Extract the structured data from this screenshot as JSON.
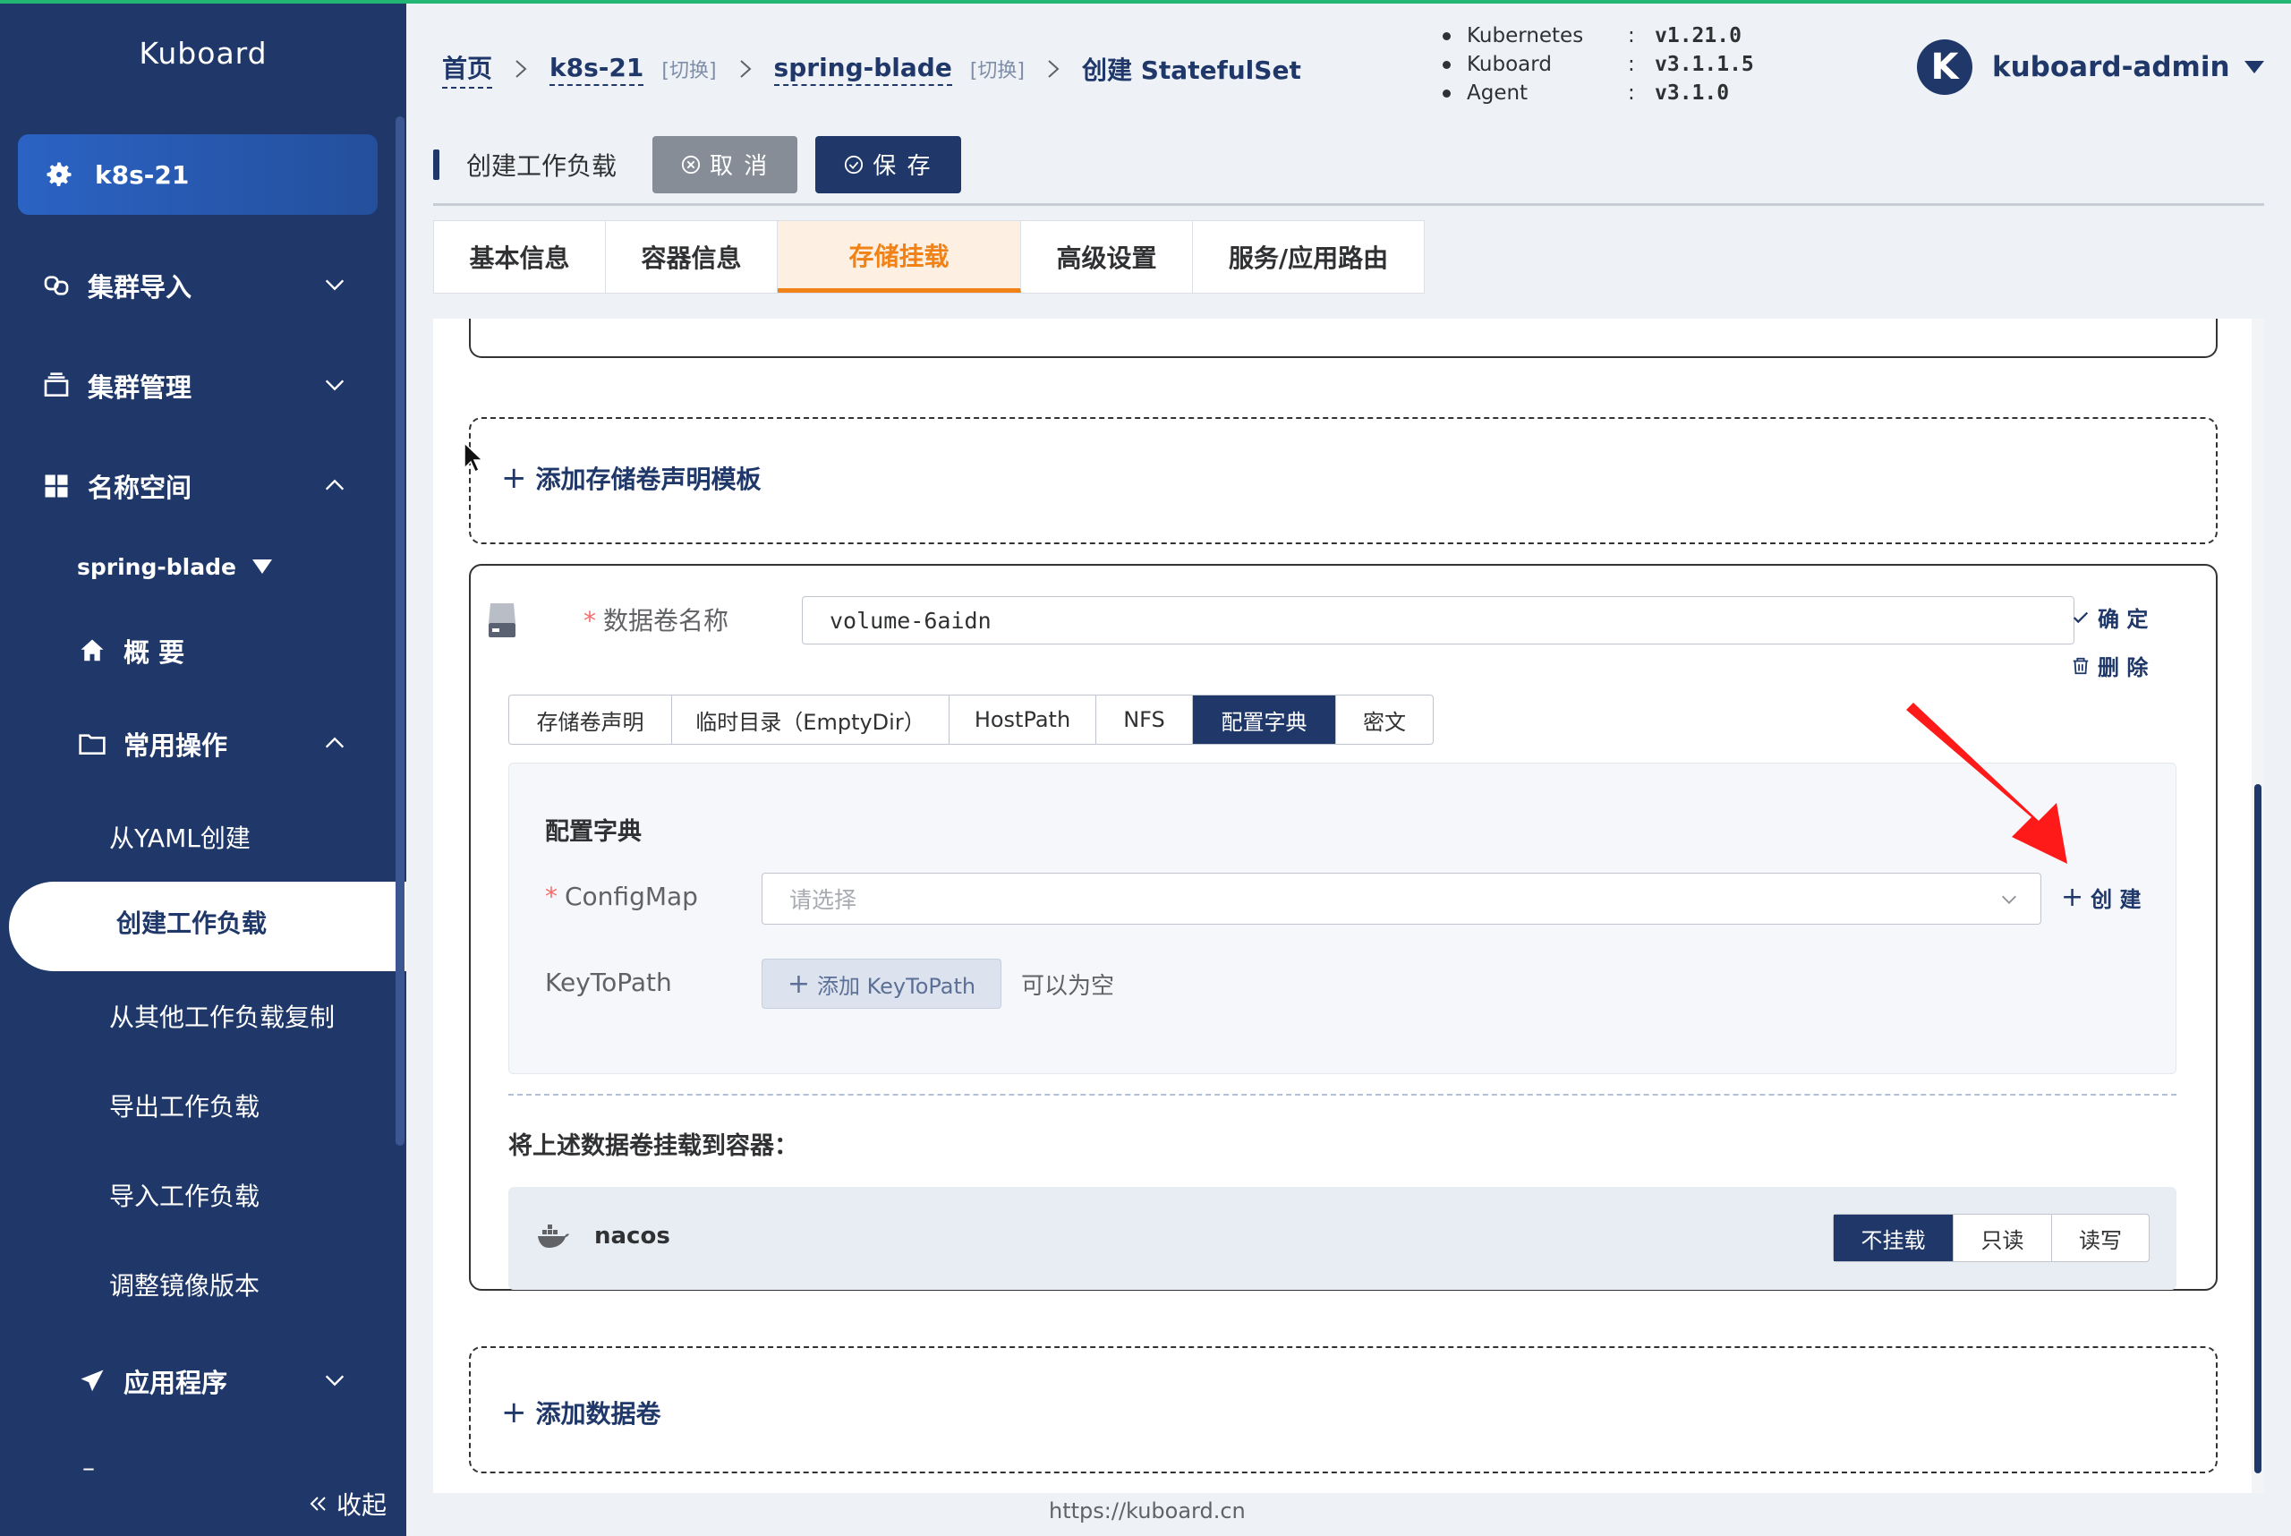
{
  "sidebar": {
    "logo": "Kuboard",
    "cluster": "k8s-21",
    "menu": {
      "cluster_import": "集群导入",
      "cluster_manage": "集群管理",
      "namespace": "名称空间",
      "namespace_name": "spring-blade",
      "overview": "概 要",
      "common_ops": "常用操作",
      "from_yaml": "从YAML创建",
      "create_workload": "创建工作负载",
      "copy_workload": "从其他工作负载复制",
      "export_workload": "导出工作负载",
      "import_workload": "导入工作负载",
      "adjust_image": "调整镜像版本",
      "applications": "应用程序",
      "partial": "–"
    },
    "collapse": "收起"
  },
  "header": {
    "breadcrumb": {
      "home": "首页",
      "cluster": "k8s-21",
      "switch1": "[切换]",
      "namespace": "spring-blade",
      "switch2": "[切换]",
      "current": "创建 StatefulSet"
    },
    "versions": [
      {
        "name": "Kubernetes",
        "value": "v1.21.0"
      },
      {
        "name": "Kuboard",
        "value": "v3.1.1.5"
      },
      {
        "name": "Agent",
        "value": "v3.1.0"
      }
    ],
    "user": {
      "initial": "K",
      "name": "kuboard-admin"
    }
  },
  "titlebar": {
    "title": "创建工作负载",
    "cancel": "取 消",
    "save": "保 存"
  },
  "tabs": [
    "基本信息",
    "容器信息",
    "存储挂载",
    "高级设置",
    "服务/应用路由"
  ],
  "active_tab": "存储挂载",
  "storage": {
    "add_pvc_template": "添加存储卷声明模板",
    "volume_name_label": "数据卷名称",
    "volume_name_value": "volume-6aidn",
    "confirm": "确 定",
    "delete": "删 除",
    "volume_types": [
      "存储卷声明",
      "临时目录（EmptyDir）",
      "HostPath",
      "NFS",
      "配置字典",
      "密文"
    ],
    "active_volume_type": "配置字典",
    "panel_title": "配置字典",
    "configmap_label": "ConfigMap",
    "configmap_placeholder": "请选择",
    "create": "创 建",
    "keytopath_label": "KeyToPath",
    "add_keytopath": "添加 KeyToPath",
    "can_be_empty": "可以为空",
    "mount_title": "将上述数据卷挂载到容器：",
    "container_name": "nacos",
    "mount_options": [
      "不挂载",
      "只读",
      "读写"
    ],
    "mount_selected": "不挂载",
    "add_volume": "添加数据卷"
  },
  "footer": "https://kuboard.cn",
  "colors": {
    "sidebar": "#1f3869",
    "accent": "#f08218",
    "annotation_arrow": "#ff1a1a"
  }
}
